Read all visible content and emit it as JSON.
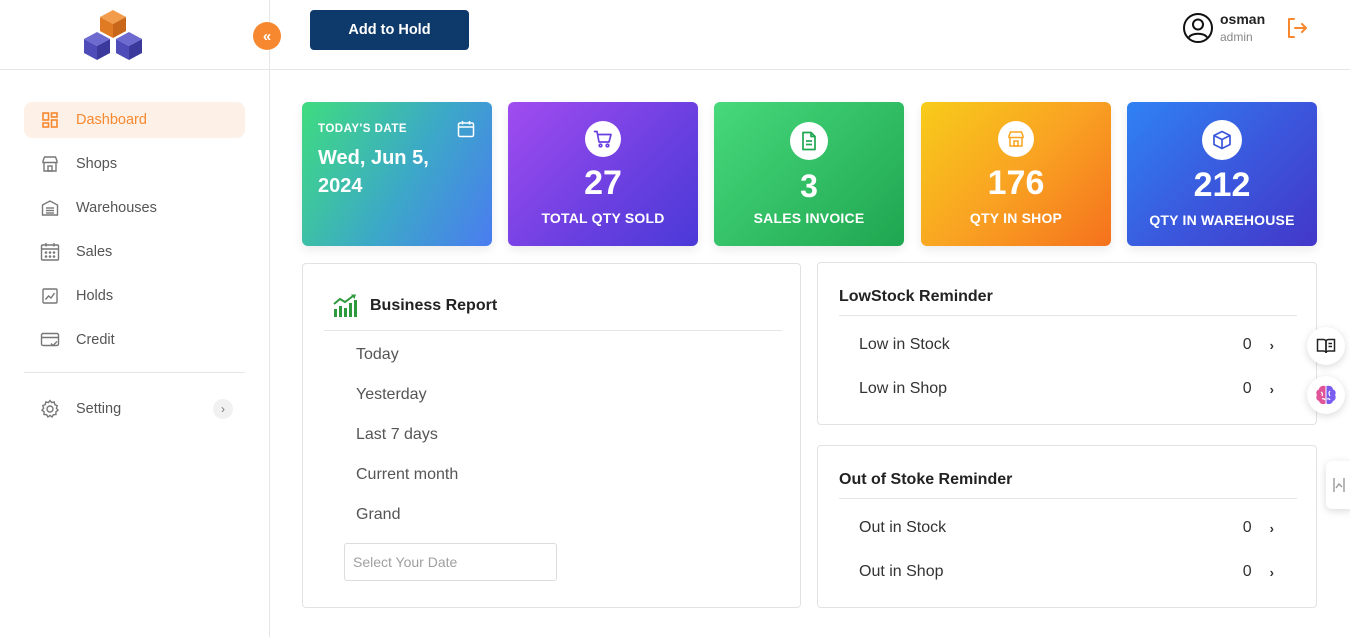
{
  "header": {
    "collapse_icon": "«",
    "add_hold_label": "Add to Hold",
    "user_name": "osman",
    "user_role": "admin"
  },
  "sidebar": {
    "items": [
      {
        "label": "Dashboard",
        "icon": "dashboard-icon",
        "active": true
      },
      {
        "label": "Shops",
        "icon": "store-icon"
      },
      {
        "label": "Warehouses",
        "icon": "warehouse-icon"
      },
      {
        "label": "Sales",
        "icon": "calendar-icon"
      },
      {
        "label": "Holds",
        "icon": "chart-icon"
      },
      {
        "label": "Credit",
        "icon": "credit-card-icon"
      }
    ],
    "setting_label": "Setting"
  },
  "stats": {
    "date_caption": "TODAY'S DATE",
    "date_value": "Wed, Jun 5, 2024",
    "qty_sold": {
      "value": "27",
      "label": "TOTAL QTY SOLD"
    },
    "sales_invoice": {
      "value": "3",
      "label": "SALES INVOICE"
    },
    "qty_shop": {
      "value": "176",
      "label": "QTY IN SHOP"
    },
    "qty_warehouse": {
      "value": "212",
      "label": "QTY IN WAREHOUSE"
    }
  },
  "business_report": {
    "title": "Business Report",
    "options": [
      "Today",
      "Yesterday",
      "Last 7 days",
      "Current month",
      "Grand"
    ],
    "date_placeholder": "Select Your Date"
  },
  "low_stock": {
    "title": "LowStock Reminder",
    "rows": [
      {
        "label": "Low in Stock",
        "value": "0"
      },
      {
        "label": "Low in Shop",
        "value": "0"
      }
    ]
  },
  "out_of_stock": {
    "title": "Out of Stoke Reminder",
    "rows": [
      {
        "label": "Out in Stock",
        "value": "0"
      },
      {
        "label": "Out in Shop",
        "value": "0"
      }
    ]
  },
  "colors": {
    "accent": "#f7882f",
    "primary_button": "#0e3a6b"
  }
}
